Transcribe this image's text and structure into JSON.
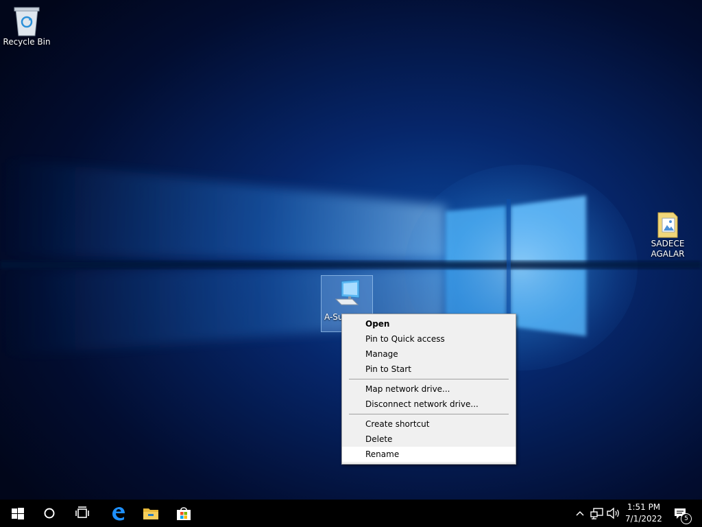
{
  "desktop": {
    "icons": [
      {
        "label": "Recycle Bin",
        "icon": "recycle-bin-icon"
      },
      {
        "label": "SADECE AGALAR",
        "icon": "folder-icon"
      },
      {
        "label": "A-Su",
        "icon": "computer-icon"
      }
    ]
  },
  "context_menu": {
    "items": [
      {
        "label": "Open"
      },
      {
        "label": "Pin to Quick access"
      },
      {
        "label": "Manage"
      },
      {
        "label": "Pin to Start"
      },
      {
        "label": "Map network drive..."
      },
      {
        "label": "Disconnect network drive..."
      },
      {
        "label": "Create shortcut"
      },
      {
        "label": "Delete"
      },
      {
        "label": "Rename"
      }
    ]
  },
  "taskbar": {
    "buttons": [
      {
        "icon": "windows-start-icon"
      },
      {
        "icon": "search-circle-icon"
      },
      {
        "icon": "task-view-icon"
      },
      {
        "icon": "edge-browser-icon"
      },
      {
        "icon": "file-explorer-icon"
      },
      {
        "icon": "microsoft-store-icon"
      }
    ],
    "tray": {
      "time": "1:51 PM",
      "date": "7/1/2022",
      "notification_count": "5"
    }
  },
  "colors": {
    "wallpaper_dark": "#010a24",
    "wallpaper_glow": "#2f8fe8",
    "menu_bg": "#f0f0f0",
    "taskbar_bg": "#000000",
    "accent_blue": "#0a78d4"
  }
}
